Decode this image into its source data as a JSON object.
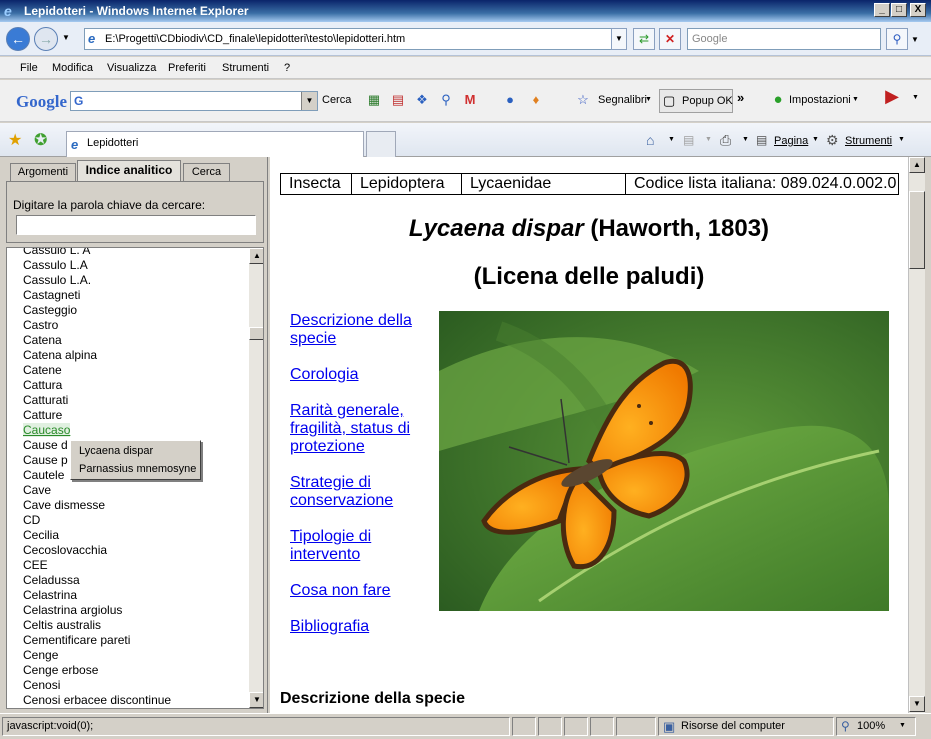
{
  "window": {
    "title": "Lepidotteri - Windows Internet Explorer",
    "minimize": "_",
    "maximize": "□",
    "close": "X"
  },
  "nav": {
    "address": "E:\\Progetti\\CDbiodiv\\CD_finale\\lepidotteri\\testo\\lepidotteri.htm",
    "search_placeholder": "Google"
  },
  "menu": {
    "items": [
      "File",
      "Modifica",
      "Visualizza",
      "Preferiti",
      "Strumenti",
      "?"
    ]
  },
  "google_toolbar": {
    "logo": "Google",
    "search_box_value": "G",
    "cerca": "Cerca",
    "segnalibri": "Segnalibri",
    "popup_ok": "Popup OK",
    "impostazioni": "Impostazioni"
  },
  "tabs": {
    "active": "Lepidotteri"
  },
  "command_bar": {
    "pagina": "Pagina",
    "strumenti": "Strumenti"
  },
  "left_panel": {
    "tabs": [
      "Argomenti",
      "Indice analitico",
      "Cerca"
    ],
    "keyword_label": "Digitare la parola chiave da cercare:",
    "keyword_value": "",
    "items": [
      "Cassulo L. A",
      "Cassulo L.A",
      "Cassulo L.A.",
      "Castagneti",
      "Casteggio",
      "Castro",
      "Catena",
      "Catena alpina",
      "Catene",
      "Cattura",
      "Catturati",
      "Catture",
      "Caucaso",
      "Cause d",
      "Cause p",
      "Cautele",
      "Cave",
      "Cave dismesse",
      "CD",
      "Cecilia",
      "Cecoslovacchia",
      "CEE",
      "Celadussa",
      "Celastrina",
      "Celastrina argiolus",
      "Celtis australis",
      "Cementificare pareti",
      "Cenge",
      "Cenge erbose",
      "Cenosi",
      "Cenosi erbacee discontinue"
    ],
    "highlighted_item": "Caucaso",
    "popup": [
      "Lycaena dispar",
      "Parnassius mnemosyne"
    ]
  },
  "content": {
    "taxonomy": [
      "Insecta",
      "Lepidoptera",
      "Lycaenidae",
      "Codice lista italiana: 089.024.0.002.0"
    ],
    "species_italic": "Lycaena dispar",
    "species_author": " (Haworth, 1803)",
    "common_name": "(Licena delle paludi)",
    "links": [
      "Descrizione della specie",
      "Corologia",
      "Rarità generale, fragilità, status di protezione",
      "Strategie di conservazione",
      "Tipologie di intervento",
      "Cosa non fare",
      "Bibliografia"
    ],
    "section_heading": "Descrizione della specie"
  },
  "status": {
    "text": "javascript:void(0);",
    "zone": "Risorse del computer",
    "zoom": "100%"
  }
}
